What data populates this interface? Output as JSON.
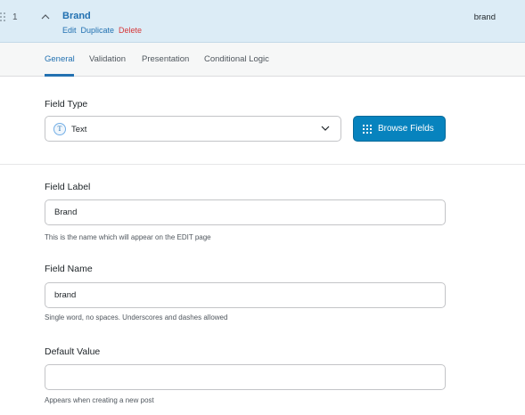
{
  "field": {
    "order": "1",
    "title": "Brand",
    "actions": {
      "edit": "Edit",
      "duplicate": "Duplicate",
      "delete": "Delete"
    },
    "key": "brand"
  },
  "tabs": [
    {
      "label": "General",
      "active": true
    },
    {
      "label": "Validation",
      "active": false
    },
    {
      "label": "Presentation",
      "active": false
    },
    {
      "label": "Conditional Logic",
      "active": false
    }
  ],
  "field_type": {
    "label": "Field Type",
    "icon_glyph": "T",
    "icon": "text-type-icon",
    "value": "Text",
    "browse_label": "Browse Fields"
  },
  "field_label": {
    "label": "Field Label",
    "value": "Brand",
    "hint": "This is the name which will appear on the EDIT page"
  },
  "field_name": {
    "label": "Field Name",
    "value": "brand",
    "hint": "Single word, no spaces. Underscores and dashes allowed"
  },
  "default_value": {
    "label": "Default Value",
    "value": "",
    "hint": "Appears when creating a new post"
  },
  "colors": {
    "accent": "#2271b1",
    "button": "#0783be",
    "header_bg": "#dcecf6",
    "delete": "#d63638"
  }
}
